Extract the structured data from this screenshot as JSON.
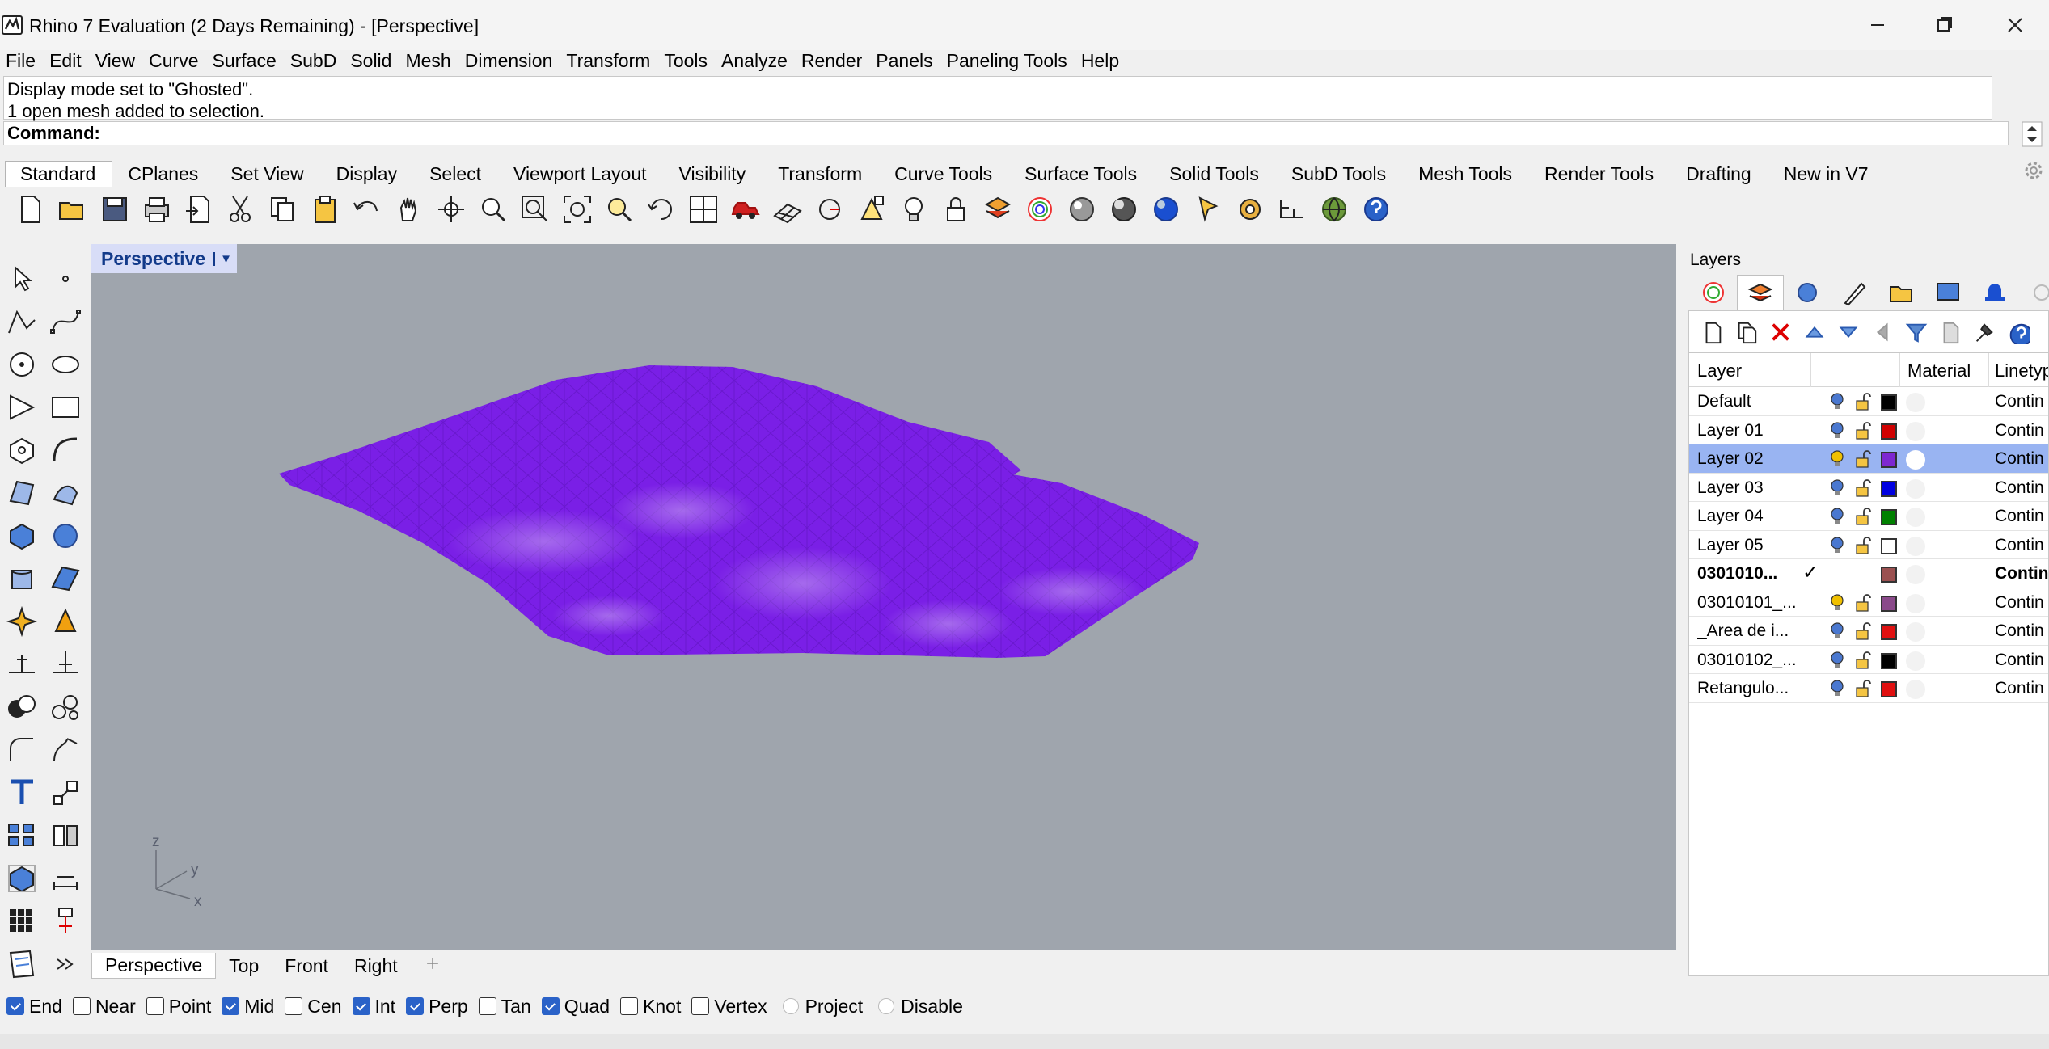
{
  "window": {
    "title": "Rhino 7 Evaluation (2 Days Remaining) - [Perspective]",
    "app_icon": "rhino-icon",
    "controls": [
      "minimize-icon",
      "restore-icon",
      "close-icon"
    ]
  },
  "menu": [
    "File",
    "Edit",
    "View",
    "Curve",
    "Surface",
    "SubD",
    "Solid",
    "Mesh",
    "Dimension",
    "Transform",
    "Tools",
    "Analyze",
    "Render",
    "Panels",
    "Paneling Tools",
    "Help"
  ],
  "command_history": [
    "Display mode set to \"Ghosted\".",
    "1 open mesh added to selection."
  ],
  "command": {
    "label": "Command:",
    "value": ""
  },
  "toolbar_tabs": [
    "Standard",
    "CPlanes",
    "Set View",
    "Display",
    "Select",
    "Viewport Layout",
    "Visibility",
    "Transform",
    "Curve Tools",
    "Surface Tools",
    "Solid Tools",
    "SubD Tools",
    "Mesh Tools",
    "Render Tools",
    "Drafting",
    "New in V7"
  ],
  "toolbar_active_tab": "Standard",
  "toolbar_icons": [
    "new-icon",
    "open-icon",
    "save-icon",
    "print-icon",
    "import-icon",
    "cut-icon",
    "copy-icon",
    "paste-icon",
    "undo-icon",
    "pan-icon",
    "rotate-view-icon",
    "zoom-icon",
    "zoom-window-icon",
    "zoom-extents-icon",
    "zoom-selected-icon",
    "rotate-icon",
    "viewport-layout-icon",
    "car-icon",
    "grid-plane-icon",
    "cplane-icon",
    "gumball-icon",
    "light-icon",
    "lock-icon",
    "layer-icon",
    "color-wheel-icon",
    "material-sphere-icon",
    "render-sphere-icon",
    "blue-sphere-icon",
    "pointer-icon",
    "options-gear-icon",
    "dimension-icon",
    "globe-icon",
    "help-icon"
  ],
  "left_tool_icons": [
    "select-icon",
    "point-icon",
    "polyline-icon",
    "curve-icon",
    "circle-icon",
    "ellipse-icon",
    "polygon-icon",
    "rectangle-icon",
    "circle-polygon-icon",
    "arc-icon",
    "surface-icon",
    "revolve-icon",
    "box-icon",
    "sphere-icon",
    "cylinder-icon",
    "plane-surface-icon",
    "explode-icon",
    "extrude-icon",
    "trim-icon",
    "split-icon",
    "boolean-icon",
    "mesh-icon",
    "fillet-icon",
    "blend-icon",
    "text-icon",
    "scale-icon",
    "array-icon",
    "mirror-icon",
    "bounding-box-icon",
    "dim-icon",
    "grid-array-icon",
    "properties-icon",
    "document-icon",
    "more-icon"
  ],
  "viewport": {
    "name": "Perspective",
    "axes": [
      "z",
      "y",
      "x"
    ]
  },
  "viewport_tabs": [
    "Perspective",
    "Top",
    "Front",
    "Right"
  ],
  "viewport_add_icon": "add-viewport-icon",
  "layers_panel": {
    "title": "Layers",
    "tab_icons": [
      "color-icon",
      "layers-icon",
      "render-icon",
      "pencil-icon",
      "folder-icon",
      "display-icon",
      "notification-icon",
      "settings-icon"
    ],
    "tool_icons": [
      "new-layer-icon",
      "new-sublayer-icon",
      "delete-icon",
      "move-up-icon",
      "move-down-icon",
      "move-left-icon",
      "filter-icon",
      "copy-layer-icon",
      "tools-icon",
      "help-icon"
    ],
    "columns": {
      "layer": "Layer",
      "material": "Material",
      "linetype": "Linetyp"
    },
    "rows": [
      {
        "name": "Default",
        "color": "#000000",
        "linetype": "Contin",
        "selected": false,
        "current": false,
        "bulb": "#4a78d0"
      },
      {
        "name": "Layer 01",
        "color": "#d00000",
        "linetype": "Contin",
        "selected": false,
        "current": false,
        "bulb": "#4a78d0"
      },
      {
        "name": "Layer 02",
        "color": "#7e28d0",
        "linetype": "Contin",
        "selected": true,
        "current": false,
        "bulb": "#f0c000"
      },
      {
        "name": "Layer 03",
        "color": "#0000e0",
        "linetype": "Contin",
        "selected": false,
        "current": false,
        "bulb": "#4a78d0"
      },
      {
        "name": "Layer 04",
        "color": "#008000",
        "linetype": "Contin",
        "selected": false,
        "current": false,
        "bulb": "#4a78d0"
      },
      {
        "name": "Layer 05",
        "color": "#ffffff",
        "linetype": "Contin",
        "selected": false,
        "current": false,
        "bulb": "#4a78d0"
      },
      {
        "name": "0301010...",
        "color": "#9a5050",
        "linetype": "Contin",
        "selected": false,
        "current": true,
        "bulb": ""
      },
      {
        "name": "03010101_...",
        "color": "#8a4a8a",
        "linetype": "Contin",
        "selected": false,
        "current": false,
        "bulb": "#f0c000"
      },
      {
        "name": "_Area de i...",
        "color": "#e01010",
        "linetype": "Contin",
        "selected": false,
        "current": false,
        "bulb": "#4a78d0"
      },
      {
        "name": "03010102_...",
        "color": "#000000",
        "linetype": "Contin",
        "selected": false,
        "current": false,
        "bulb": "#4a78d0"
      },
      {
        "name": "Retangulo...",
        "color": "#e01010",
        "linetype": "Contin",
        "selected": false,
        "current": false,
        "bulb": "#4a78d0"
      }
    ],
    "current_mark": "✓"
  },
  "osnaps": [
    {
      "label": "End",
      "checked": true,
      "type": "check"
    },
    {
      "label": "Near",
      "checked": false,
      "type": "check"
    },
    {
      "label": "Point",
      "checked": false,
      "type": "check"
    },
    {
      "label": "Mid",
      "checked": true,
      "type": "check"
    },
    {
      "label": "Cen",
      "checked": false,
      "type": "check"
    },
    {
      "label": "Int",
      "checked": true,
      "type": "check"
    },
    {
      "label": "Perp",
      "checked": true,
      "type": "check"
    },
    {
      "label": "Tan",
      "checked": false,
      "type": "check"
    },
    {
      "label": "Quad",
      "checked": true,
      "type": "check"
    },
    {
      "label": "Knot",
      "checked": false,
      "type": "check"
    },
    {
      "label": "Vertex",
      "checked": false,
      "type": "check"
    },
    {
      "label": "Project",
      "checked": false,
      "type": "radio"
    },
    {
      "label": "Disable",
      "checked": false,
      "type": "radio"
    }
  ],
  "colors": {
    "mesh": "#7a1fe6",
    "viewport_bg": "#9fa5ad",
    "selection": "#99b4f2",
    "accent": "#2a62c8"
  }
}
